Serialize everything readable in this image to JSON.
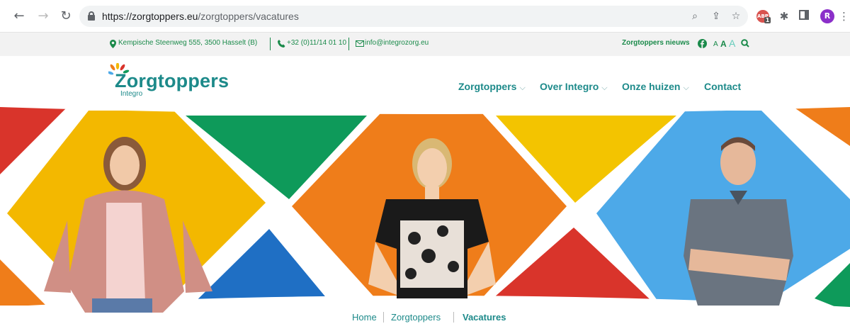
{
  "browser": {
    "url_host": "https://zorgtoppers.eu",
    "url_path": "/zorgtoppers/vacatures",
    "abp_label": "ABP",
    "abp_count": "1",
    "profile_initial": "R"
  },
  "topbar": {
    "address": "Kempische Steenweg 555, 3500 Hasselt (B)",
    "phone": "+32 (0)11/14 01 10",
    "email": "info@integrozorg.eu",
    "news_label": "Zorgtoppers nieuws",
    "font_sizes": [
      "A",
      "A",
      "A"
    ]
  },
  "header": {
    "logo_text": "Zorgtoppers",
    "logo_sub": "Integro",
    "menu": [
      {
        "label": "Zorgtoppers",
        "has_dropdown": true
      },
      {
        "label": "Over Integro",
        "has_dropdown": true
      },
      {
        "label": "Onze huizen",
        "has_dropdown": true
      },
      {
        "label": "Contact",
        "has_dropdown": false
      }
    ]
  },
  "breadcrumb": {
    "items": [
      "Home",
      "Zorgtoppers",
      "Vacatures"
    ]
  },
  "colors": {
    "brand": "#1d8a8a",
    "topbar_green": "#1a8a4a",
    "red": "#d9342b",
    "yellow": "#f3b800",
    "green": "#0e9a5a",
    "orange": "#ef7d1a",
    "blue": "#1f6fc4",
    "lightblue": "#4da9e8"
  }
}
